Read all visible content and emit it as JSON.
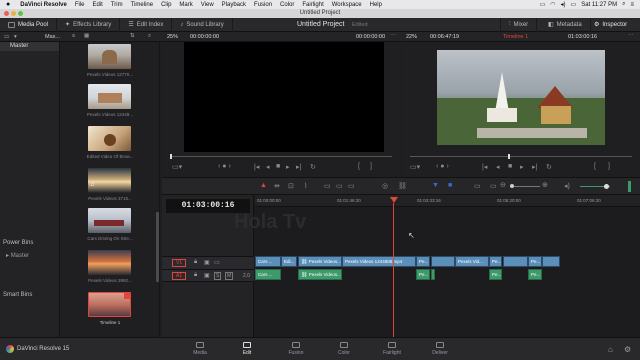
{
  "menubar": {
    "apple": "",
    "app": "DaVinci Resolve",
    "items": [
      "File",
      "Edit",
      "Trim",
      "Timeline",
      "Clip",
      "Mark",
      "View",
      "Playback",
      "Fusion",
      "Color",
      "Fairlight",
      "Workspace",
      "Help"
    ],
    "clock": "Sat 11:27 PM"
  },
  "window_title": "Untitled Project",
  "toolbar": {
    "media_pool": "Media Pool",
    "effects_library": "Effects Library",
    "edit_index": "Edit Index",
    "sound_library": "Sound Library",
    "project_name": "Untitled Project",
    "edited": "Edited",
    "mixer": "Mixer",
    "metadata": "Metadata",
    "inspector": "Inspector"
  },
  "subbar": {
    "bin_label": "Mas...",
    "src_zoom": "25%",
    "src_tc_left": "00:00:00:00",
    "src_tc_right": "00:00:00:00",
    "pgm_zoom": "22%",
    "pgm_tc": "00:06:47:19",
    "timeline_name": "Timeline 1",
    "pgm_tc_right": "01:03:00:16"
  },
  "bins": {
    "master": "Master",
    "power_bins": "Power Bins",
    "power_master": "Master",
    "smart_bins": "Smart Bins"
  },
  "clips": [
    {
      "caption": "Pexels Videos 12770..."
    },
    {
      "caption": "Pexels Videos 12449..."
    },
    {
      "caption": "Edited Video Of Brow..."
    },
    {
      "caption": "Pexels Videos 3715..."
    },
    {
      "caption": "Cars Driving On Stre..."
    },
    {
      "caption": "Pexels Videos 3992..."
    },
    {
      "caption": "Timeline 1"
    }
  ],
  "timeline": {
    "timecode": "01:03:00:16",
    "ruler": [
      "01:00:00:00",
      "01:01:46:20",
      "01:03:33:16",
      "01:05:20:00",
      "01:07:06:20"
    ],
    "v1": "V1",
    "a1": "A1",
    "a1_level": "2.0",
    "watermark": "Hola Tv",
    "video_clips": [
      {
        "label": "Cars ..."
      },
      {
        "label": "Edi..."
      },
      {
        "label": "Pexels Videos..."
      },
      {
        "label": "Pexels Videos 1244888.mp4"
      },
      {
        "label": "Pe..."
      },
      {
        "label": "Pexels Vid..."
      },
      {
        "label": "Pe..."
      },
      {
        "label": "Pe..."
      },
      {
        "label": ""
      }
    ],
    "audio_clips": [
      {
        "label": "Cars ..."
      },
      {
        "label": "Pexels Videos..."
      },
      {
        "label": "Pe..."
      },
      {
        "label": "Pe..."
      },
      {
        "label": "Pe..."
      }
    ]
  },
  "pages": [
    "Media",
    "Edit",
    "Fusion",
    "Color",
    "Fairlight",
    "Deliver"
  ],
  "active_page": "Edit",
  "brand": "DaVinci Resolve 15",
  "colors": {
    "accent_red": "#e0463c",
    "video_clip": "#5b8fb9",
    "audio_clip": "#3d9a6a",
    "timeline_red": "#e0463c"
  }
}
